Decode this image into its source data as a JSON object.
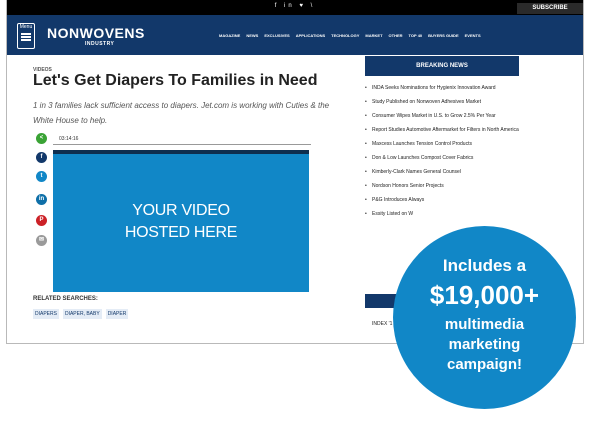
{
  "topbar": {
    "social": "f  in  ♥  \\",
    "subscribe": "SUBSCRIBE"
  },
  "navbar": {
    "menu_label": "Menu",
    "logo": "NONWOVENS",
    "logo_sub": "INDUSTRY",
    "items": [
      "MAGAZINE",
      "NEWS",
      "EXCLUSIVES",
      "APPLICATIONS",
      "TECHNOLOGY",
      "MARKET",
      "OTHER",
      "TOP 40",
      "BUYERS GUIDE",
      "EVENTS"
    ]
  },
  "article": {
    "section": "VIDEOS",
    "headline": "Let's Get Diapers To Families in Need",
    "deck": "1 in 3 families lack sufficient access to diapers. Jet.com is working with Cuties & the White House to help.",
    "timecode": "03:14:16",
    "video_line1": "YOUR VIDEO",
    "video_line2": "HOSTED HERE",
    "related_label": "RELATED SEARCHES:",
    "tags": [
      "DIAPERS",
      "DIAPER, BABY",
      "DIAPER"
    ]
  },
  "share_icons": [
    {
      "name": "share-icon",
      "glyph": "<",
      "color": "#3aa335"
    },
    {
      "name": "facebook-icon",
      "glyph": "f",
      "color": "#12386a"
    },
    {
      "name": "twitter-icon",
      "glyph": "t",
      "color": "#1187c7"
    },
    {
      "name": "linkedin-icon",
      "glyph": "in",
      "color": "#0e6fa8"
    },
    {
      "name": "pinterest-icon",
      "glyph": "P",
      "color": "#cc2127"
    },
    {
      "name": "email-icon",
      "glyph": "✉",
      "color": "#9a9a9a"
    }
  ],
  "sidebar": {
    "heading": "BREAKING NEWS",
    "news": [
      "INDA Seeks Nominations for Hygienix Innovation Award",
      "Study Published on Nonwoven Adhesives Market",
      "Consumer Wipes Market in U.S. to Grow 2.5% Per Year",
      "Report Studies Automotive Aftermarket for Filters in North America",
      "Maxcess Launches Tension Control Products",
      "Don & Low Launches Compost Cover Fabrics",
      "Kimberly-Clark Names General Counsel",
      "Nordson Honors Senior Projects",
      "P&G Introduces Always",
      "Essity Listed on W"
    ],
    "last_item": "INDEX '1"
  },
  "badge": {
    "line1": "Includes a",
    "line2": "$19,000+",
    "line3": "multimedia",
    "line4": "marketing",
    "line5": "campaign!"
  }
}
